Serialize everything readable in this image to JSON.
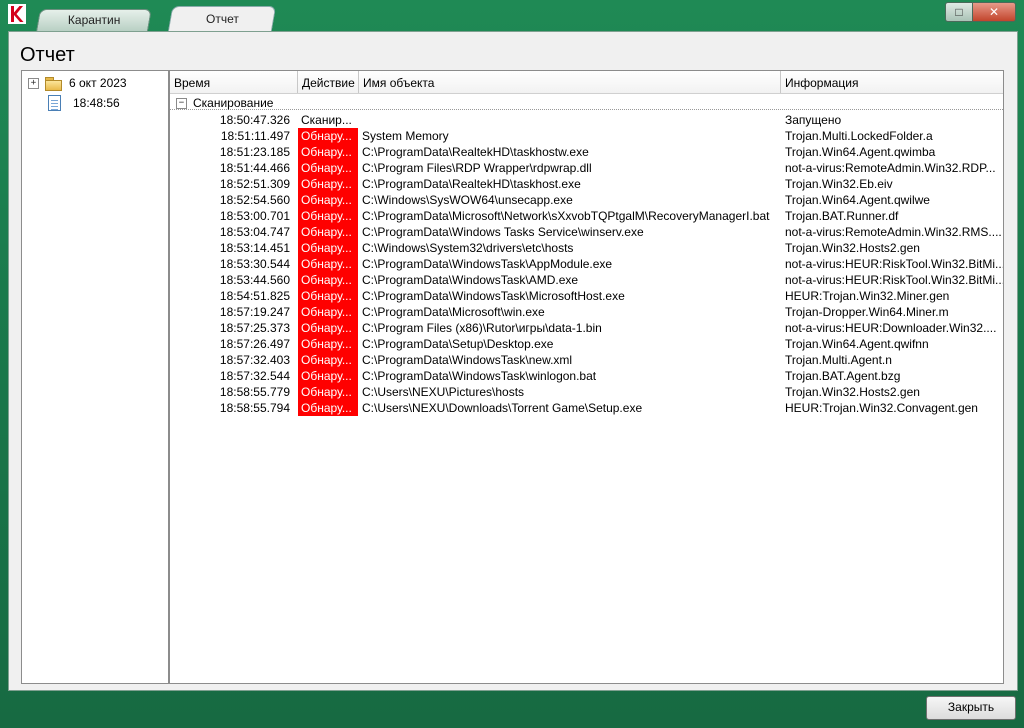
{
  "window": {
    "tabs": [
      {
        "label": "Карантин"
      },
      {
        "label": "Отчет"
      }
    ],
    "buttons": {
      "maximize": "□",
      "close": "✕"
    }
  },
  "page_title": "Отчет",
  "tree": {
    "date_label": "6 окт 2023",
    "expander": "+",
    "session_label": "18:48:56"
  },
  "grid": {
    "columns": [
      "Время",
      "Действие",
      "Имя объекта",
      "Информация"
    ],
    "group": {
      "expander": "−",
      "label": "Сканирование"
    },
    "rows": [
      {
        "time": "18:50:47.326",
        "action": "Сканир...",
        "object": "",
        "info": "Запущено",
        "detected": false
      },
      {
        "time": "18:51:11.497",
        "action": "Обнару...",
        "object": "System Memory",
        "info": "Trojan.Multi.LockedFolder.a",
        "detected": true
      },
      {
        "time": "18:51:23.185",
        "action": "Обнару...",
        "object": "C:\\ProgramData\\RealtekHD\\taskhostw.exe",
        "info": "Trojan.Win64.Agent.qwimba",
        "detected": true
      },
      {
        "time": "18:51:44.466",
        "action": "Обнару...",
        "object": "C:\\Program Files\\RDP Wrapper\\rdpwrap.dll",
        "info": "not-a-virus:RemoteAdmin.Win32.RDP...",
        "detected": true
      },
      {
        "time": "18:52:51.309",
        "action": "Обнару...",
        "object": "C:\\ProgramData\\RealtekHD\\taskhost.exe",
        "info": "Trojan.Win32.Eb.eiv",
        "detected": true
      },
      {
        "time": "18:52:54.560",
        "action": "Обнару...",
        "object": "C:\\Windows\\SysWOW64\\unsecapp.exe",
        "info": "Trojan.Win64.Agent.qwilwe",
        "detected": true
      },
      {
        "time": "18:53:00.701",
        "action": "Обнару...",
        "object": "C:\\ProgramData\\Microsoft\\Network\\sXxvobTQPtgalM\\RecoveryManagerI.bat",
        "info": "Trojan.BAT.Runner.df",
        "detected": true
      },
      {
        "time": "18:53:04.747",
        "action": "Обнару...",
        "object": "C:\\ProgramData\\Windows Tasks Service\\winserv.exe",
        "info": "not-a-virus:RemoteAdmin.Win32.RMS....",
        "detected": true
      },
      {
        "time": "18:53:14.451",
        "action": "Обнару...",
        "object": "C:\\Windows\\System32\\drivers\\etc\\hosts",
        "info": "Trojan.Win32.Hosts2.gen",
        "detected": true
      },
      {
        "time": "18:53:30.544",
        "action": "Обнару...",
        "object": "C:\\ProgramData\\WindowsTask\\AppModule.exe",
        "info": "not-a-virus:HEUR:RiskTool.Win32.BitMi...",
        "detected": true
      },
      {
        "time": "18:53:44.560",
        "action": "Обнару...",
        "object": "C:\\ProgramData\\WindowsTask\\AMD.exe",
        "info": "not-a-virus:HEUR:RiskTool.Win32.BitMi...",
        "detected": true
      },
      {
        "time": "18:54:51.825",
        "action": "Обнару...",
        "object": "C:\\ProgramData\\WindowsTask\\MicrosoftHost.exe",
        "info": "HEUR:Trojan.Win32.Miner.gen",
        "detected": true
      },
      {
        "time": "18:57:19.247",
        "action": "Обнару...",
        "object": "C:\\ProgramData\\Microsoft\\win.exe",
        "info": "Trojan-Dropper.Win64.Miner.m",
        "detected": true
      },
      {
        "time": "18:57:25.373",
        "action": "Обнару...",
        "object": "C:\\Program Files (x86)\\Rutor\\игры\\data-1.bin",
        "info": "not-a-virus:HEUR:Downloader.Win32....",
        "detected": true
      },
      {
        "time": "18:57:26.497",
        "action": "Обнару...",
        "object": "C:\\ProgramData\\Setup\\Desktop.exe",
        "info": "Trojan.Win64.Agent.qwifnn",
        "detected": true
      },
      {
        "time": "18:57:32.403",
        "action": "Обнару...",
        "object": "C:\\ProgramData\\WindowsTask\\new.xml",
        "info": "Trojan.Multi.Agent.n",
        "detected": true
      },
      {
        "time": "18:57:32.544",
        "action": "Обнару...",
        "object": "C:\\ProgramData\\WindowsTask\\winlogon.bat",
        "info": "Trojan.BAT.Agent.bzg",
        "detected": true
      },
      {
        "time": "18:58:55.779",
        "action": "Обнару...",
        "object": "C:\\Users\\NEXU\\Pictures\\hosts",
        "info": "Trojan.Win32.Hosts2.gen",
        "detected": true
      },
      {
        "time": "18:58:55.794",
        "action": "Обнару...",
        "object": "C:\\Users\\NEXU\\Downloads\\Torrent Game\\Setup.exe",
        "info": "HEUR:Trojan.Win32.Convagent.gen",
        "detected": true
      }
    ]
  },
  "footer": {
    "close_label": "Закрыть"
  },
  "colors": {
    "detected": "#ff0000",
    "chrome": "#1f8a55"
  }
}
